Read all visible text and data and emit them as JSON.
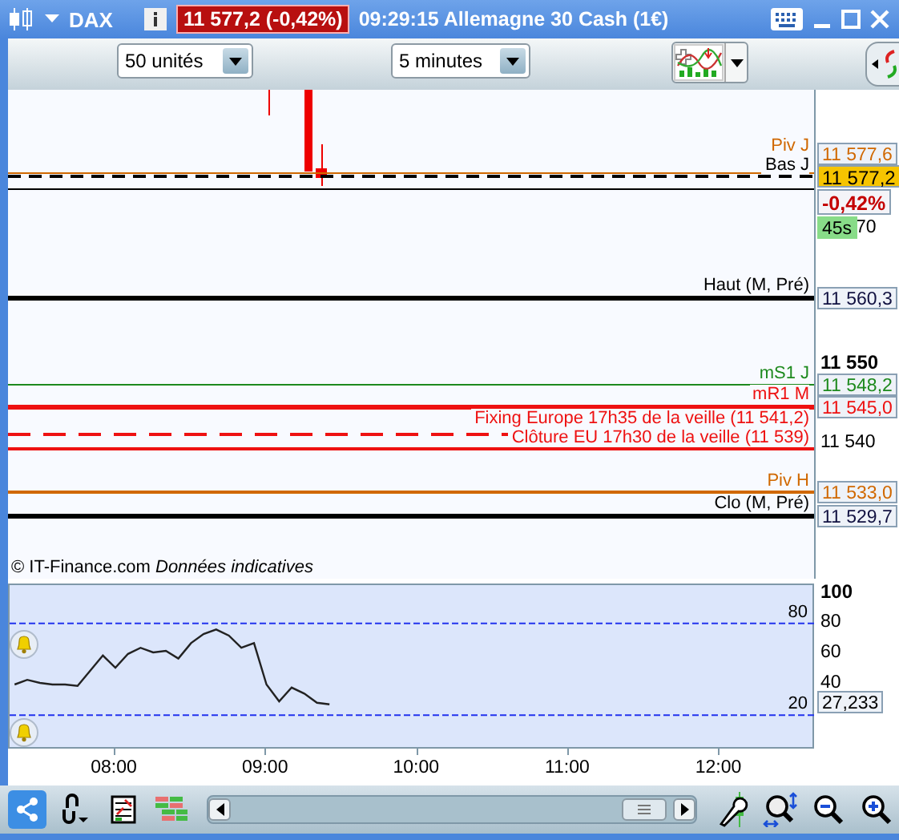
{
  "window": {
    "title": "DAX",
    "quote": "11 577,2 (-0,42%)",
    "subtitle": "09:29:15 Allemagne 30 Cash (1€)"
  },
  "toolbar": {
    "units": "50 unités",
    "period": "5 minutes"
  },
  "price_chart": {
    "axis_labels": [
      "70",
      "11 550",
      "11 540"
    ],
    "levels": [
      {
        "kind": "thin",
        "label": "Piv J",
        "tag": "11 577,6",
        "color": "#d06800"
      },
      {
        "kind": "current",
        "label": "Bas J",
        "tag": "11 577,2",
        "color": "#000000"
      },
      {
        "kind": "thin"
      },
      {
        "kind": "thick",
        "label": "Haut (M, Pré)",
        "tag": "11 560,3",
        "color": "#000000"
      },
      {
        "kind": "thin",
        "label": "mS1 J",
        "tag": "11 548,2",
        "color": "#1e8a1e"
      },
      {
        "kind": "thick",
        "label": "mR1 M",
        "tag": "11 545,0",
        "color": "#ee1111"
      },
      {
        "kind": "dashed",
        "label": "Fixing Europe 17h35 de la veille (11 541,2)",
        "color": "#ee1111"
      },
      {
        "kind": "medium",
        "label": "Clôture EU 17h30 de la veille (11 539)",
        "color": "#ee1111"
      },
      {
        "kind": "medium",
        "label": "Piv H",
        "tag": "11 533,0",
        "color": "#d06800"
      },
      {
        "kind": "thick",
        "label": "Clo (M, Pré)",
        "tag": "11 529,7",
        "color": "#000000"
      }
    ],
    "current": {
      "change": "-0,42%",
      "countdown": "45s"
    },
    "credit": "© IT-Finance.com",
    "disclaimer": "Données indicatives"
  },
  "oscillator": {
    "chart_data": {
      "type": "line",
      "x": [
        440,
        445,
        450,
        455,
        460,
        465,
        470,
        475,
        480,
        485,
        490,
        495,
        500,
        505,
        510,
        515,
        520,
        525,
        530,
        535,
        540,
        545,
        550,
        555,
        560,
        565
      ],
      "series": [
        {
          "color": "#222222",
          "values": [
            40,
            43,
            41,
            40,
            40,
            39,
            49,
            59,
            51,
            60,
            64,
            61,
            62,
            57,
            67,
            73,
            76,
            72,
            64,
            67,
            40,
            29,
            38,
            34,
            28,
            27
          ]
        }
      ],
      "xlim": [
        438,
        758
      ],
      "ylim": [
        -3,
        105
      ],
      "xticks": [
        {
          "value": 480,
          "label": "08:00"
        },
        {
          "value": 540,
          "label": "09:00"
        },
        {
          "value": 600,
          "label": "10:00"
        },
        {
          "value": 660,
          "label": "11:00"
        },
        {
          "value": 720,
          "label": "12:00"
        }
      ],
      "yticks": [
        {
          "value": 100,
          "label": "100"
        },
        {
          "value": 80,
          "label": "80"
        },
        {
          "value": 60,
          "label": "60"
        },
        {
          "value": 40,
          "label": "40"
        }
      ],
      "ref_lines": [
        {
          "axis": "y",
          "value": 80,
          "label": "80"
        },
        {
          "axis": "y",
          "value": 20,
          "label": "20"
        }
      ],
      "annotations": [
        "27,233"
      ]
    }
  }
}
